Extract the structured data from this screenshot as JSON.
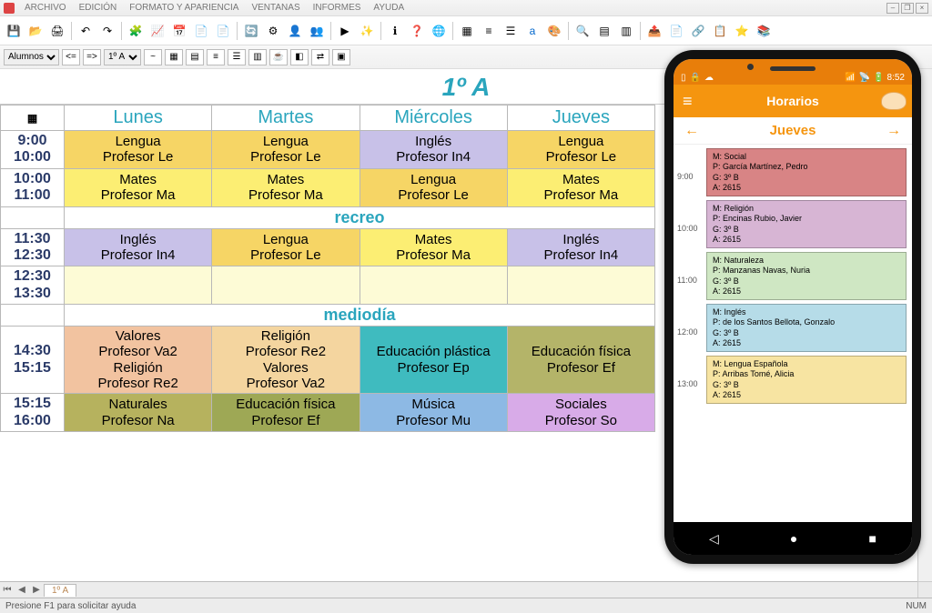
{
  "menu": {
    "items": [
      "ARCHIVO",
      "EDICIÓN",
      "FORMATO Y APARIENCIA",
      "VENTANAS",
      "INFORMES",
      "AYUDA"
    ]
  },
  "secondbar": {
    "dropdown1": "Alumnos",
    "dropdown2": "1º A"
  },
  "page_title": "1º A",
  "days": [
    "Lunes",
    "Martes",
    "Miércoles",
    "Jueves"
  ],
  "times": [
    "9:00\n10:00",
    "10:00\n11:00",
    "11:30\n12:30",
    "12:30\n13:30",
    "14:30\n15:15",
    "15:15\n16:00"
  ],
  "breaks": {
    "recreo": "recreo",
    "mediodia": "mediodía"
  },
  "rows": [
    [
      {
        "s": "Lengua",
        "p": "Profesor Le",
        "c": "bg-yellow1"
      },
      {
        "s": "Lengua",
        "p": "Profesor Le",
        "c": "bg-yellow1"
      },
      {
        "s": "Inglés",
        "p": "Profesor In4",
        "c": "bg-lilac"
      },
      {
        "s": "Lengua",
        "p": "Profesor Le",
        "c": "bg-yellow1"
      }
    ],
    [
      {
        "s": "Mates",
        "p": "Profesor Ma",
        "c": "bg-yellow2"
      },
      {
        "s": "Mates",
        "p": "Profesor Ma",
        "c": "bg-yellow2"
      },
      {
        "s": "Lengua",
        "p": "Profesor Le",
        "c": "bg-yellow1"
      },
      {
        "s": "Mates",
        "p": "Profesor Ma",
        "c": "bg-yellow2"
      }
    ],
    [
      {
        "s": "Inglés",
        "p": "Profesor In4",
        "c": "bg-lilac"
      },
      {
        "s": "Lengua",
        "p": "Profesor Le",
        "c": "bg-yellow1"
      },
      {
        "s": "Mates",
        "p": "Profesor Ma",
        "c": "bg-yellow2"
      },
      {
        "s": "Inglés",
        "p": "Profesor In4",
        "c": "bg-lilac"
      }
    ],
    [
      {
        "s": "",
        "p": "",
        "c": "bg-cream"
      },
      {
        "s": "",
        "p": "",
        "c": "bg-cream"
      },
      {
        "s": "",
        "p": "",
        "c": "bg-cream"
      },
      {
        "s": "",
        "p": "",
        "c": "bg-cream"
      }
    ],
    [
      {
        "s": "Valores",
        "p": "Profesor Va2",
        "s2": "Religión",
        "p2": "Profesor Re2",
        "c": "bg-pink"
      },
      {
        "s": "Religión",
        "p": "Profesor Re2",
        "s2": "Valores",
        "p2": "Profesor Va2",
        "c": "bg-orange"
      },
      {
        "s": "Educación plástica",
        "p": "Profesor Ep",
        "c": "bg-teal"
      },
      {
        "s": "Educación física",
        "p": "Profesor Ef",
        "c": "bg-olive"
      }
    ],
    [
      {
        "s": "Naturales",
        "p": "Profesor Na",
        "c": "bg-olive2"
      },
      {
        "s": "Educación física",
        "p": "Profesor Ef",
        "c": "bg-dkolive"
      },
      {
        "s": "Música",
        "p": "Profesor Mu",
        "c": "bg-blue"
      },
      {
        "s": "Sociales",
        "p": "Profesor So",
        "c": "bg-magenta"
      }
    ]
  ],
  "sheettab": "1º A",
  "statusbar": {
    "help": "Presione F1 para solicitar ayuda",
    "num": "NUM"
  },
  "phone": {
    "time": "8:52",
    "header": "Horarios",
    "day": "Jueves",
    "items": [
      {
        "time": "9:00",
        "m": "M: Social",
        "p": "P: García Martínez, Pedro",
        "g": "G: 3º B",
        "a": "A: 2615",
        "cls": "l1"
      },
      {
        "time": "10:00",
        "m": "M: Religión",
        "p": "P: Encinas Rubio, Javier",
        "g": "G: 3º B",
        "a": "A: 2615",
        "cls": "l2"
      },
      {
        "time": "11:00",
        "m": "M: Naturaleza",
        "p": "P: Manzanas Navas, Nuria",
        "g": "G: 3º B",
        "a": "A: 2615",
        "cls": "l3"
      },
      {
        "time": "12:00",
        "m": "M: Inglés",
        "p": "P: de los Santos Bellota, Gonzalo",
        "g": "G: 3º B",
        "a": "A: 2615",
        "cls": "l4"
      },
      {
        "time": "13:00",
        "m": "M: Lengua Española",
        "p": "P: Arribas Tomé, Alicia",
        "g": "G: 3º B",
        "a": "A: 2615",
        "cls": "l5"
      }
    ]
  }
}
